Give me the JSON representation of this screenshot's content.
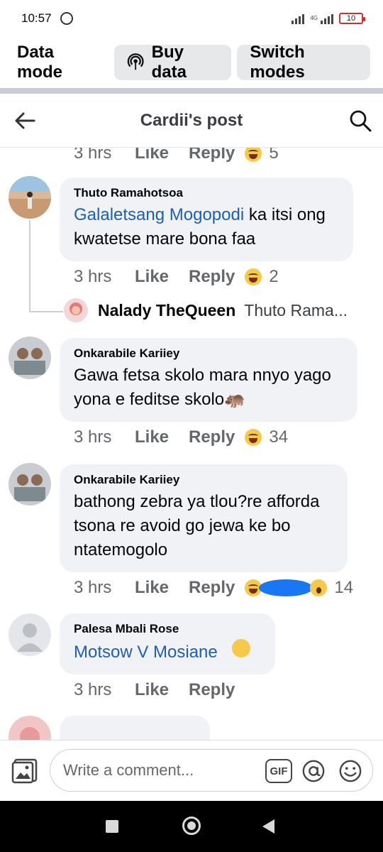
{
  "status_bar": {
    "time": "10:57",
    "network": "4G",
    "battery": "10"
  },
  "data_bar": {
    "mode_label": "Data mode",
    "buy_data": "Buy data",
    "switch_modes": "Switch modes"
  },
  "header": {
    "title": "Cardii's post"
  },
  "top_meta": {
    "time": "3 hrs",
    "like": "Like",
    "reply": "Reply",
    "count": "5"
  },
  "comments": [
    {
      "author": "Thuto Ramahotsoa",
      "tag": "Galaletsang Mogopodi",
      "text": " ka itsi ong kwatetse mare bona faa",
      "time": "3 hrs",
      "like": "Like",
      "reply": "Reply",
      "count": "2"
    },
    {
      "author": "Onkarabile Kariiey",
      "text": "Gawa fetsa skolo mara nnyo yago yona e feditse skolo🦛",
      "time": "3 hrs",
      "like": "Like",
      "reply": "Reply",
      "count": "34"
    },
    {
      "author": "Onkarabile Kariiey",
      "text": "bathong zebra ya tlou?re afforda tsona re avoid go jewa ke bo ntatemogolo",
      "time": "3 hrs",
      "like": "Like",
      "reply": "Reply",
      "count": "14"
    },
    {
      "author": "Palesa Mbali Rose",
      "tag": "Motsow V Mosiane",
      "time": "3 hrs",
      "like": "Like",
      "reply": "Reply"
    }
  ],
  "reply_preview": {
    "author": "Nalady TheQueen",
    "text": "Thuto Rama..."
  },
  "composer": {
    "placeholder": "Write a comment...",
    "gif": "GIF"
  },
  "colors": {
    "link": "#1b5fb8",
    "bubble": "#f0f2f5",
    "meta": "#65676b"
  }
}
